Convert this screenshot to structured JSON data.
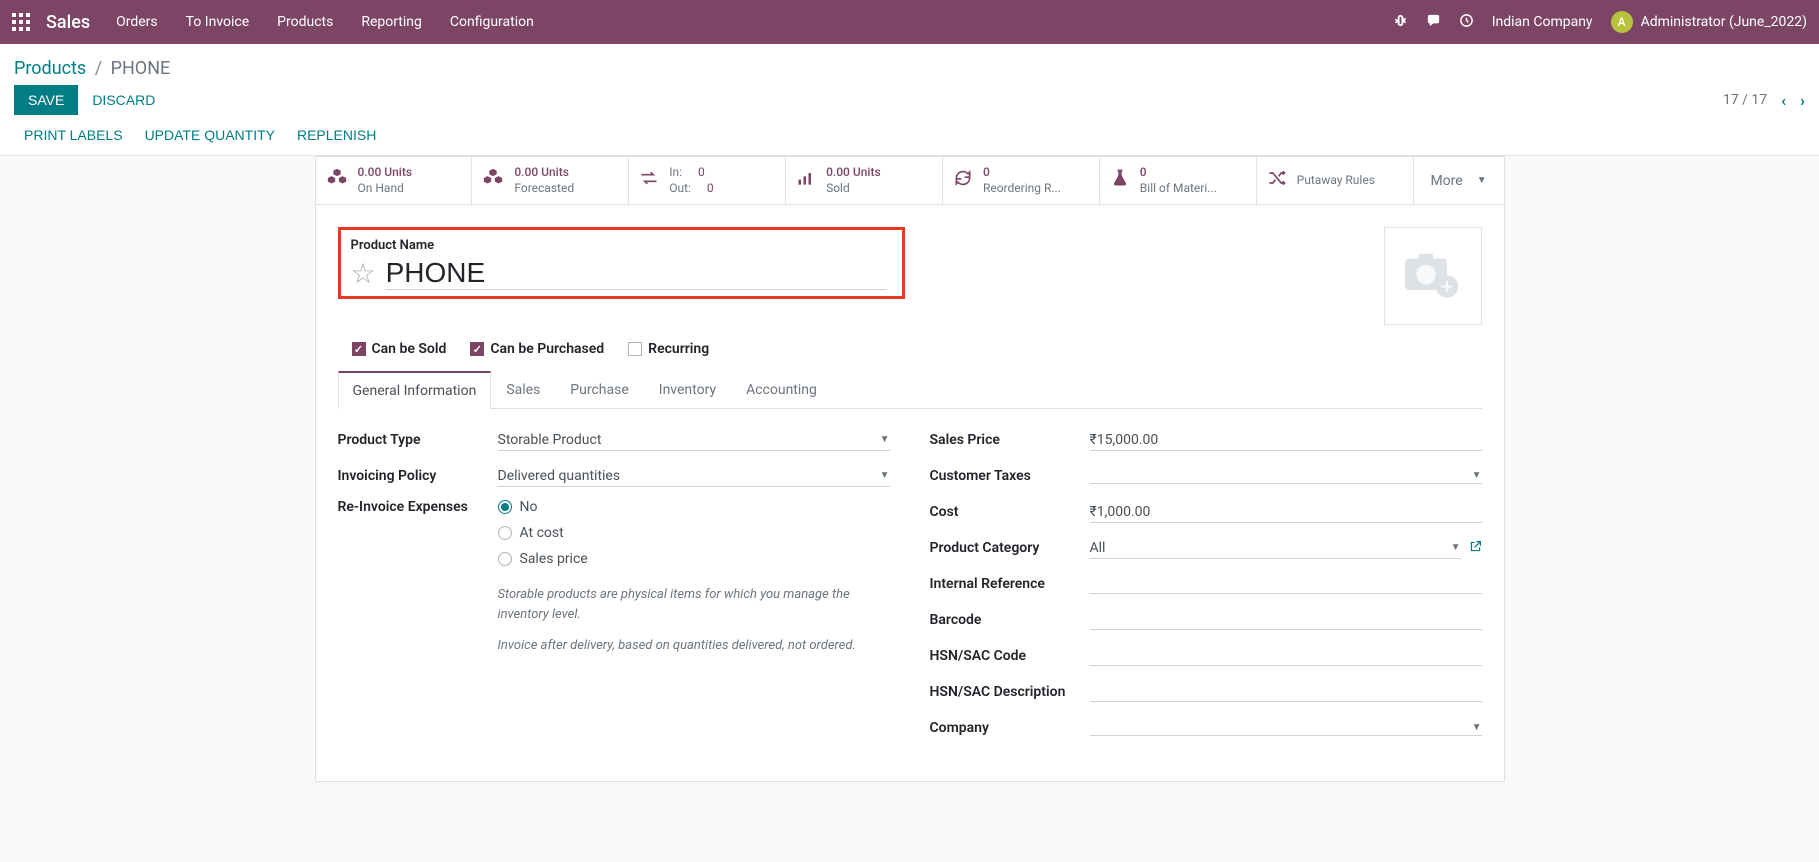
{
  "nav": {
    "brand": "Sales",
    "links": [
      "Orders",
      "To Invoice",
      "Products",
      "Reporting",
      "Configuration"
    ],
    "company": "Indian Company",
    "avatar_letter": "A",
    "user": "Administrator (June_2022)"
  },
  "breadcrumb": {
    "root": "Products",
    "current": "PHONE"
  },
  "buttons": {
    "save": "SAVE",
    "discard": "DISCARD"
  },
  "pager": {
    "text": "17 / 17"
  },
  "actions": {
    "print_labels": "PRINT LABELS",
    "update_qty": "UPDATE QUANTITY",
    "replenish": "REPLENISH"
  },
  "stats": {
    "onhand": {
      "value": "0.00 Units",
      "label": "On Hand"
    },
    "forecast": {
      "value": "0.00 Units",
      "label": "Forecasted"
    },
    "inout": {
      "in_label": "In:",
      "in_val": "0",
      "out_label": "Out:",
      "out_val": "0"
    },
    "sold": {
      "value": "0.00 Units",
      "label": "Sold"
    },
    "reorder": {
      "value": "0",
      "label": "Reordering R..."
    },
    "bom": {
      "value": "0",
      "label": "Bill of Materi..."
    },
    "putaway": {
      "label": "Putaway Rules"
    },
    "more": "More"
  },
  "product": {
    "name_label": "Product Name",
    "name": "PHONE",
    "can_sold": "Can be Sold",
    "can_purchased": "Can be Purchased",
    "recurring": "Recurring"
  },
  "tabs": [
    "General Information",
    "Sales",
    "Purchase",
    "Inventory",
    "Accounting"
  ],
  "fields_left": {
    "product_type": {
      "label": "Product Type",
      "value": "Storable Product"
    },
    "invoicing_policy": {
      "label": "Invoicing Policy",
      "value": "Delivered quantities"
    },
    "reinvoice": {
      "label": "Re-Invoice Expenses",
      "opts": {
        "no": "No",
        "cost": "At cost",
        "sales": "Sales price"
      }
    },
    "help1": "Storable products are physical items for which you manage the inventory level.",
    "help2": "Invoice after delivery, based on quantities delivered, not ordered."
  },
  "fields_right": {
    "sales_price": {
      "label": "Sales Price",
      "value": "₹15,000.00"
    },
    "customer_taxes": {
      "label": "Customer Taxes",
      "value": ""
    },
    "cost": {
      "label": "Cost",
      "value": "₹1,000.00"
    },
    "category": {
      "label": "Product Category",
      "value": "All"
    },
    "internal_ref": {
      "label": "Internal Reference",
      "value": ""
    },
    "barcode": {
      "label": "Barcode",
      "value": ""
    },
    "hsn_code": {
      "label": "HSN/SAC Code",
      "value": ""
    },
    "hsn_desc": {
      "label": "HSN/SAC Description",
      "value": ""
    },
    "company": {
      "label": "Company",
      "value": ""
    }
  }
}
